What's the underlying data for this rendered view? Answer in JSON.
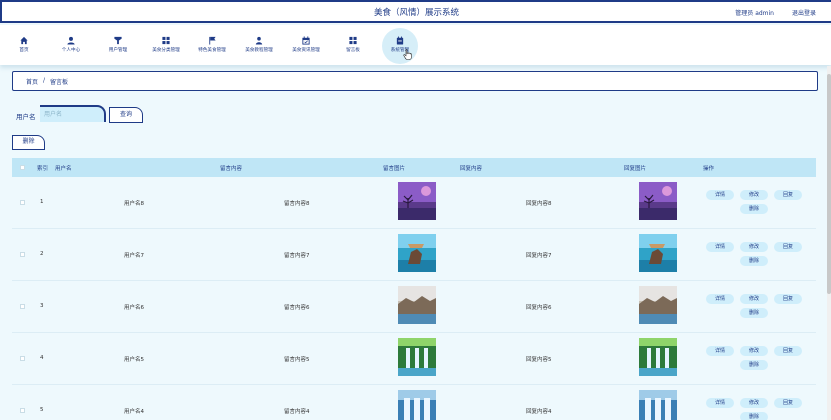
{
  "header": {
    "title": "美食（风情）展示系统",
    "user": "管理员 admin",
    "logout": "退出登录"
  },
  "nav": [
    {
      "label": "首页",
      "icon": "home-icon"
    },
    {
      "label": "个人中心",
      "icon": "user-icon"
    },
    {
      "label": "用户管理",
      "icon": "users-icon"
    },
    {
      "label": "美食分类管理",
      "icon": "grid-icon"
    },
    {
      "label": "特色美食管理",
      "icon": "flag-icon"
    },
    {
      "label": "美食教程管理",
      "icon": "person-icon"
    },
    {
      "label": "美食资讯管理",
      "icon": "calendar-icon"
    },
    {
      "label": "留言板",
      "icon": "grid-icon"
    },
    {
      "label": "系统管理",
      "icon": "settings-icon"
    }
  ],
  "breadcrumb": {
    "home": "首页",
    "sep": "/",
    "current": "留言板"
  },
  "search": {
    "label": "用户名",
    "placeholder": "用户名",
    "button": "查询"
  },
  "delete_button": "删除",
  "table": {
    "headers": [
      "索引",
      "用户名",
      "留言内容",
      "留言图片",
      "回复内容",
      "回复图片",
      "操作"
    ],
    "rows": [
      {
        "index": "1",
        "username": "用户名8",
        "content": "留言内容8",
        "reply": "回复内容8",
        "image": "purple-night-tree"
      },
      {
        "index": "2",
        "username": "用户名7",
        "content": "留言内容7",
        "reply": "回复内容7",
        "image": "ocean-rock"
      },
      {
        "index": "3",
        "username": "用户名6",
        "content": "留言内容6",
        "reply": "回复内容6",
        "image": "rocky-coast"
      },
      {
        "index": "4",
        "username": "用户名5",
        "content": "留言内容5",
        "reply": "回复内容5",
        "image": "waterfall-forest"
      },
      {
        "index": "5",
        "username": "用户名4",
        "content": "留言内容4",
        "reply": "回复内容4",
        "image": "waterfall-blue"
      }
    ],
    "actions": {
      "detail": "详情",
      "edit": "修改",
      "reply": "回复",
      "delete": "删除"
    }
  },
  "colors": {
    "primary": "#1f3b87",
    "accent_light": "#cfeefb",
    "header_row": "#bfe6f6",
    "background": "#eef9fd"
  }
}
